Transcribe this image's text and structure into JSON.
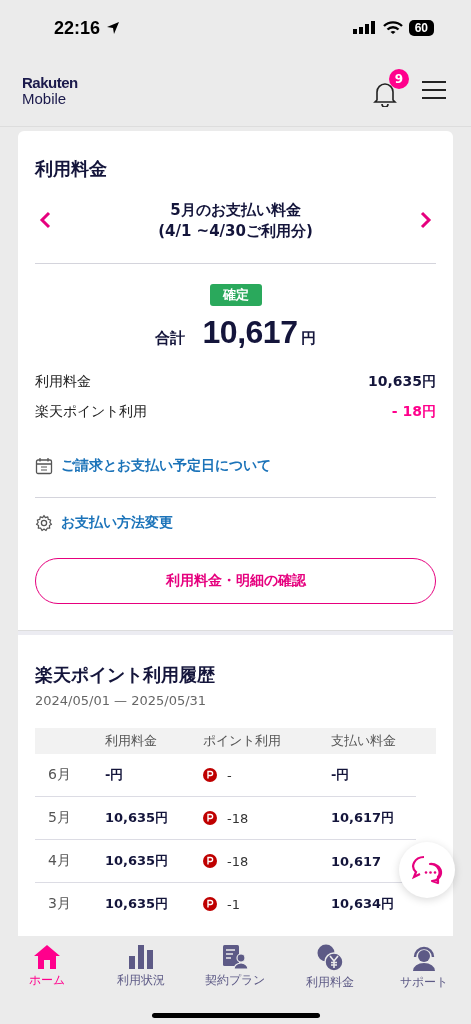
{
  "status_bar": {
    "time": "22:16",
    "battery": "60"
  },
  "header": {
    "logo_top": "Rakuten",
    "logo_bottom": "Mobile",
    "notification_count": "9"
  },
  "billing": {
    "title": "利用料金",
    "month_title": "5月のお支払い料金",
    "period": "(4/1 ~4/30ご利用分)",
    "status": "確定",
    "total_label": "合計",
    "total_amount": "10,617",
    "total_unit": "円",
    "lines": [
      {
        "label": "利用料金",
        "value": "10,635円",
        "kind": "charge"
      },
      {
        "label": "楽天ポイント利用",
        "value": "- 18円",
        "kind": "discount"
      }
    ],
    "links": [
      {
        "label": "ご請求とお支払い予定日について"
      },
      {
        "label": "お支払い方法変更"
      }
    ],
    "button": "利用料金・明細の確認"
  },
  "points_history": {
    "title": "楽天ポイント利用履歴",
    "range": "2024/05/01 — 2025/05/31",
    "columns": [
      "利用料金",
      "ポイント利用",
      "支払い料金"
    ],
    "rows": [
      {
        "month": "6月",
        "usage": "-円",
        "points": "-",
        "payment": "-円"
      },
      {
        "month": "5月",
        "usage": "10,635円",
        "points": "-18",
        "payment": "10,617円"
      },
      {
        "month": "4月",
        "usage": "10,635円",
        "points": "-18",
        "payment": "10,617"
      },
      {
        "month": "3月",
        "usage": "10,635円",
        "points": "-1",
        "payment": "10,634円"
      }
    ]
  },
  "bottom_nav": [
    {
      "label": "ホーム",
      "selected": true
    },
    {
      "label": "利用状況",
      "selected": false
    },
    {
      "label": "契約プラン",
      "selected": false
    },
    {
      "label": "利用料金",
      "selected": false
    },
    {
      "label": "サポート",
      "selected": false
    }
  ]
}
